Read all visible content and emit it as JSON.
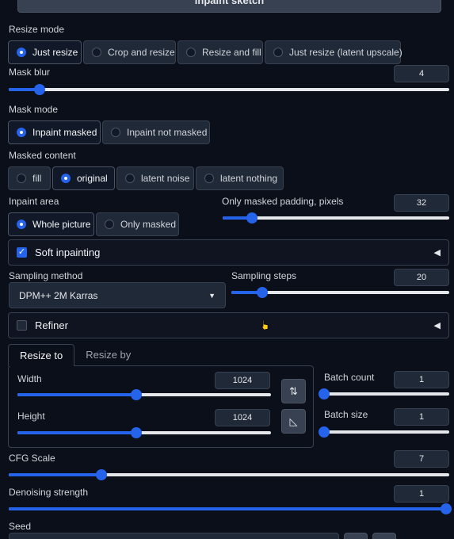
{
  "top_button": {
    "label": "Inpaint sketch"
  },
  "resize_mode": {
    "label": "Resize mode",
    "options": [
      "Just resize",
      "Crop and resize",
      "Resize and fill",
      "Just resize (latent upscale)"
    ],
    "selected": 0
  },
  "mask_blur": {
    "label": "Mask blur",
    "value": "4",
    "fraction": 0.07
  },
  "mask_mode": {
    "label": "Mask mode",
    "options": [
      "Inpaint masked",
      "Inpaint not masked"
    ],
    "selected": 0
  },
  "masked_content": {
    "label": "Masked content",
    "options": [
      "fill",
      "original",
      "latent noise",
      "latent nothing"
    ],
    "selected": 1
  },
  "inpaint_area": {
    "label": "Inpaint area",
    "options": [
      "Whole picture",
      "Only masked"
    ],
    "selected": 0
  },
  "padding": {
    "label": "Only masked padding, pixels",
    "value": "32",
    "fraction": 0.13
  },
  "soft_inpainting": {
    "label": "Soft inpainting",
    "checked": true,
    "caret": "◀"
  },
  "sampling_method": {
    "label": "Sampling method",
    "value": "DPM++ 2M Karras",
    "arrow": "▼"
  },
  "sampling_steps": {
    "label": "Sampling steps",
    "value": "20",
    "fraction": 0.14
  },
  "refiner": {
    "label": "Refiner",
    "checked": false,
    "caret": "◀"
  },
  "resize_tabs": {
    "tabs": [
      "Resize to",
      "Resize by"
    ],
    "active": 0
  },
  "width": {
    "label": "Width",
    "value": "1024",
    "fraction": 0.47
  },
  "height": {
    "label": "Height",
    "value": "1024",
    "fraction": 0.47
  },
  "swap_icon": "⇅",
  "ratio_icon": "◺",
  "batch_count": {
    "label": "Batch count",
    "value": "1",
    "fraction": 0.0
  },
  "batch_size": {
    "label": "Batch size",
    "value": "1",
    "fraction": 0.0
  },
  "cfg_scale": {
    "label": "CFG Scale",
    "value": "7",
    "fraction": 0.21
  },
  "denoising": {
    "label": "Denoising strength",
    "value": "1",
    "fraction": 1.0
  },
  "seed": {
    "label": "Seed"
  },
  "colors": {
    "accent": "#2563eb",
    "background": "#0b0f19",
    "panel": "#1f2937"
  }
}
